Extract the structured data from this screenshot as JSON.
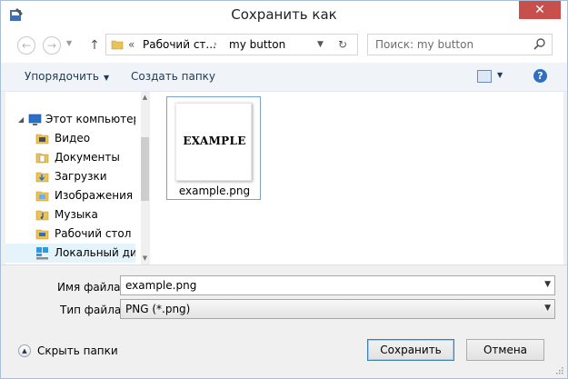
{
  "window": {
    "title": "Сохранить как",
    "close_glyph": "✕",
    "title_icon": "save-dialog-icon"
  },
  "nav": {
    "back_glyph": "←",
    "forward_glyph": "→",
    "up_glyph": "↑",
    "breadcrumb_sep": "«",
    "breadcrumb_parent": "Рабочий ст...",
    "breadcrumb_current": "my button",
    "refresh_glyph": "↻",
    "search_placeholder": "Поиск: my button"
  },
  "toolbar": {
    "organize_label": "Упорядочить",
    "new_folder_label": "Создать папку",
    "help_glyph": "?"
  },
  "sidebar": {
    "items": [
      {
        "label": "Этот компьютер",
        "icon": "computer-icon"
      },
      {
        "label": "Видео",
        "icon": "video-folder-icon"
      },
      {
        "label": "Документы",
        "icon": "documents-folder-icon"
      },
      {
        "label": "Загрузки",
        "icon": "downloads-folder-icon"
      },
      {
        "label": "Изображения",
        "icon": "pictures-folder-icon"
      },
      {
        "label": "Музыка",
        "icon": "music-folder-icon"
      },
      {
        "label": "Рабочий стол",
        "icon": "desktop-folder-icon"
      },
      {
        "label": "Локальный диск",
        "icon": "local-disk-icon"
      }
    ]
  },
  "files": [
    {
      "name": "example.png",
      "thumbnail_text": "EXAMPLE"
    }
  ],
  "form": {
    "filename_label": "Имя файла:",
    "filename_value": "example.png",
    "filetype_label": "Тип файла:",
    "filetype_value": "PNG (*.png)"
  },
  "footer": {
    "hide_folders_label": "Скрыть папки",
    "save_label": "Сохранить",
    "cancel_label": "Отмена"
  },
  "colors": {
    "close_button": "#c7504d",
    "accent": "#3c7fb1",
    "folder": "#e8c25a"
  }
}
